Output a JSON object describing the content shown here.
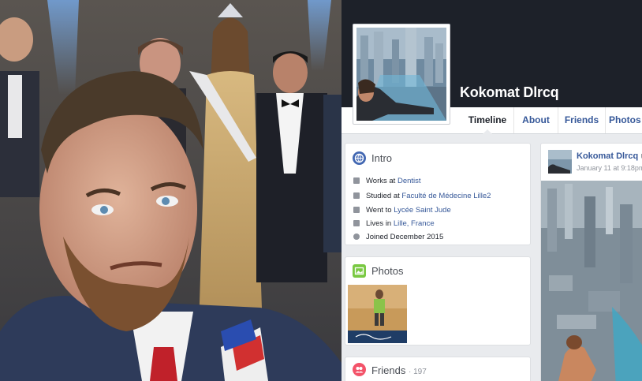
{
  "profile": {
    "name": "Kokomat Dlrcq",
    "tabs": [
      {
        "label": "Timeline",
        "active": true
      },
      {
        "label": "About",
        "active": false
      },
      {
        "label": "Friends",
        "active": false
      },
      {
        "label": "Photos",
        "active": false
      }
    ]
  },
  "intro": {
    "title": "Intro",
    "works_prefix": "Works at ",
    "works_link": "Dentist",
    "studied_prefix": "Studied at ",
    "studied_link": "Faculté de Médecine Lille2",
    "went_prefix": "Went to ",
    "went_link": "Lycée Saint Jude",
    "lives_prefix": "Lives in ",
    "lives_link": "Lille, France",
    "joined": "Joined December 2015"
  },
  "photos": {
    "title": "Photos"
  },
  "friends": {
    "title": "Friends",
    "count": "· 197"
  },
  "post": {
    "author": "Kokomat Dlrcq",
    "author_suffix": "u",
    "date": "January 11 at 9:18pm"
  },
  "colors": {
    "link": "#365899",
    "cover": "#1d2129",
    "background": "#e9ebee",
    "intro_icon": "#4267b2",
    "photos_icon": "#7ac943",
    "friends_icon": "#f35369"
  }
}
